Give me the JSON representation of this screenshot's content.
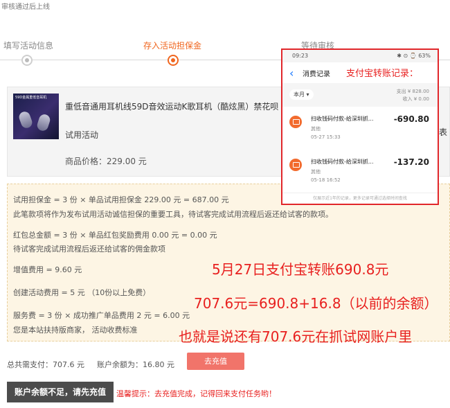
{
  "top_note": "审核通过后上线",
  "steps": [
    {
      "label": "填写活动信息",
      "active": false
    },
    {
      "label": "存入活动担保金",
      "active": true
    },
    {
      "label": "等待审核",
      "active": false
    }
  ],
  "product": {
    "thumb_text": "59D金属重低音耳机",
    "title": "重低音通用耳机线59D音效运动K歌耳机（酷炫黑）禁花呗",
    "type": "试用活动",
    "price": "商品价格：229.00 元",
    "side_char": "表"
  },
  "fees": {
    "deposit": "试用担保金 = 3 份 × 单品试用担保金 229.00 元 = 687.00 元",
    "deposit_note": "此笔款项将作为发布试用活动诚信担保的重要工具，待试客完成试用流程后返还给试客的款项。",
    "redpacket": "红包总金额 = 3 份 × 单品红包奖励费用 0.00 元 = 0.00 元",
    "redpacket_note": "待试客完成试用流程后返还给试客的佣金款项",
    "value_added": "增值费用 = 9.60 元",
    "create_fee": "创建活动费用 = 5 元 （10份以上免费）",
    "service_fee": "服务费 = 3 份 × 成功推广单品费用 2 元 = 6.00 元",
    "merchant_note": "您是本站扶持版商家， 活动收费标准"
  },
  "annotations": {
    "line1": "5月27日支付宝转账690.8元",
    "line2": "707.6元=690.8+16.8（以前的余额）",
    "line3": "也就是说还有707.6元在抓试网账户里"
  },
  "phone": {
    "status_time": "09:23",
    "status_right": "✱ ⊙ ⌚ 63%",
    "nav_title": "消费记录",
    "annotation": "支付宝转账记录：",
    "month": "本月",
    "expense": "支出 ¥ 828.00",
    "income": "收入 ¥ 0.00",
    "transactions": [
      {
        "name": "扫收钱码付款-给深圳抓...",
        "category": "其他",
        "date": "05-27  15:33",
        "amount": "-690.80"
      },
      {
        "name": "扫收钱码付款-给深圳抓...",
        "category": "其他",
        "date": "05-18  16:52",
        "amount": "-137.20"
      }
    ],
    "footer": "仅展示近1年的记录，更多记录可通过选择时间查找"
  },
  "bottom": {
    "total": "总共需支付：707.6 元",
    "balance": "账户余额为：16.80 元",
    "recharge_btn": "去充值",
    "insufficient_btn": "账户余额不足，请先充值",
    "tip": "温馨提示：去充值完成，记得回来支付任务哟！"
  },
  "colors": {
    "accent": "#f0661f",
    "annotation_red": "#e8201f",
    "recharge_btn": "#f1746a",
    "alipay_blue": "#1677ff"
  }
}
